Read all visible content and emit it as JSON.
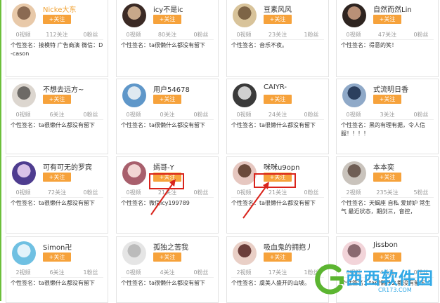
{
  "follow_label": "+关注",
  "sig_prefix": "个性签名：",
  "cards": [
    {
      "name": "Nicke大东",
      "name_color": "#f0a030",
      "videos": "0视频",
      "follows": "112关注",
      "fans": "0粉丝",
      "sig": "接模特 广告商演 微信：D-cason"
    },
    {
      "name": "icy不是ic",
      "videos": "0视频",
      "follows": "80关注",
      "fans": "0粉丝",
      "sig": "ta很懒什么都没有留下"
    },
    {
      "name": "豆素风风",
      "videos": "0视频",
      "follows": "23关注",
      "fans": "1粉丝",
      "sig": "音乐不夜。"
    },
    {
      "name": "自然而然Lin",
      "videos": "0视频",
      "follows": "47关注",
      "fans": "0粉丝",
      "sig": "得意的笑！"
    },
    {
      "name": "不想去远方~",
      "videos": "0视频",
      "follows": "6关注",
      "fans": "0粉丝",
      "sig": "ta很懒什么都没有留下"
    },
    {
      "name": "用户54678",
      "videos": "0视频",
      "follows": "0关注",
      "fans": "0粉丝",
      "sig": "ta很懒什么都没有留下"
    },
    {
      "name": "CAIYR-",
      "videos": "0视频",
      "follows": "24关注",
      "fans": "0粉丝",
      "sig": "ta很懒什么都没有留下"
    },
    {
      "name": "式流明日香",
      "videos": "0视频",
      "follows": "3关注",
      "fans": "0粉丝",
      "sig": "黑的有理有据，令人信服！！！！"
    },
    {
      "name": "可有可无的罗宾",
      "videos": "0视频",
      "follows": "72关注",
      "fans": "0粉丝",
      "sig": "ta很懒什么都没有留下"
    },
    {
      "name": "嫣哥-Y",
      "videos": "0视频",
      "follows": "21关注",
      "fans": "0粉丝",
      "sig": "微信icy199789"
    },
    {
      "name": "咪咪u9opn",
      "videos": "0视频",
      "follows": "21关注",
      "fans": "0粉丝",
      "sig": "ta很懒什么都没有留下"
    },
    {
      "name": "本本奕",
      "videos": "2视频",
      "follows": "235关注",
      "fans": "5粉丝",
      "sig": "天蝎座 自私 爱娇妒 常生气 最近状态，期剑三，音控，"
    },
    {
      "name": "Simon卍",
      "videos": "2视频",
      "follows": "6关注",
      "fans": "1粉丝",
      "sig": "ta很懒什么都没有留下"
    },
    {
      "name": "孤独之苦我",
      "videos": "0视频",
      "follows": "4关注",
      "fans": "0粉丝",
      "sig": "ta很懒什么都没有留下"
    },
    {
      "name": "吸血鬼的拥抱丿",
      "videos": "2视频",
      "follows": "17关注",
      "fans": "1粉丝",
      "sig": "虞美人盛开的山坡。"
    },
    {
      "name": "Jissbon",
      "videos": "0视频",
      "follows": "4关注",
      "fans": "0粉丝",
      "sig": "ta很懒什么都没有留下"
    }
  ],
  "watermark": {
    "main": "西西软件园",
    "sub": "CR173.COM"
  },
  "colors": {
    "follow_bg": "#f6a23b",
    "highlight": "#d9241c",
    "accent_green": "#6cbf3a",
    "watermark_blue": "#31a9e6"
  }
}
